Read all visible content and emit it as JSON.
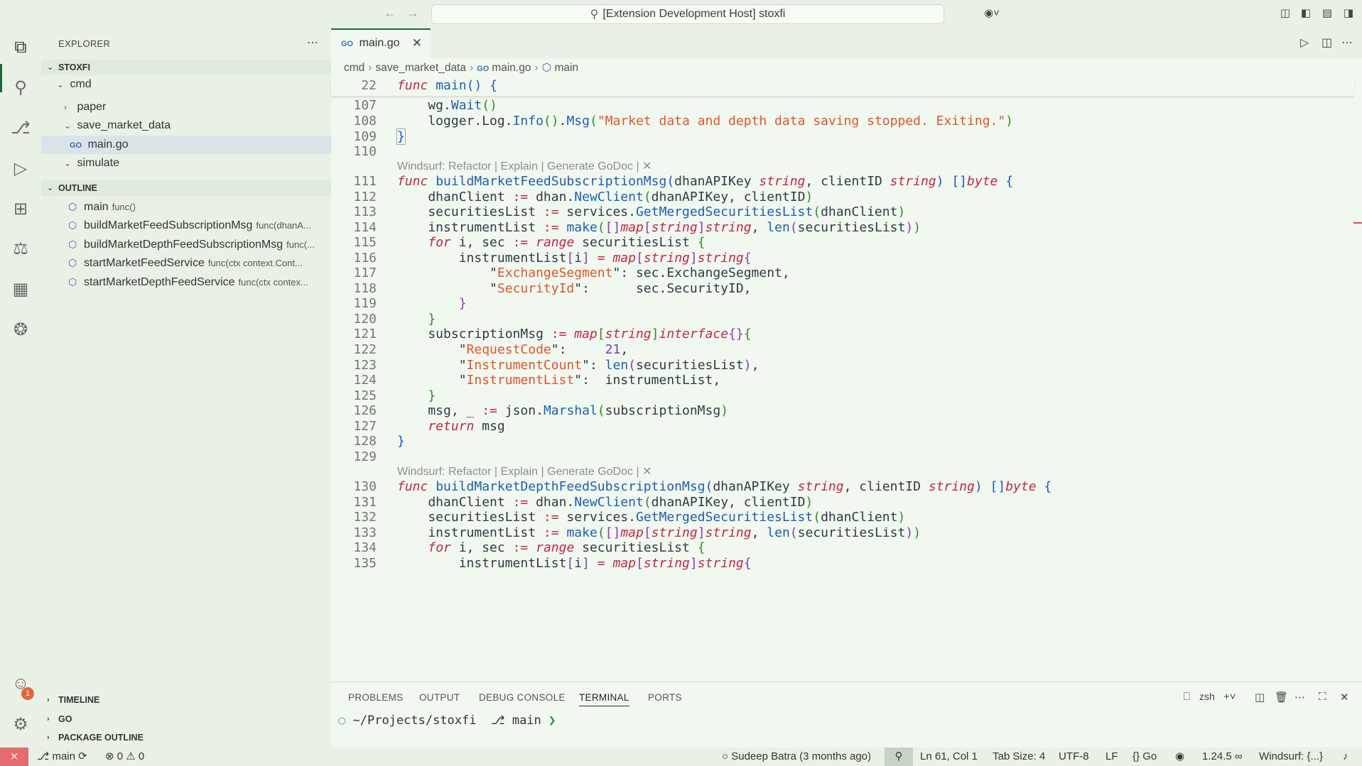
{
  "titlebar": {
    "search_text": "[Extension Development Host] stoxfi"
  },
  "sidebar": {
    "title": "EXPLORER",
    "folder": "STOXFI",
    "tree": [
      {
        "label": "cmd"
      },
      {
        "label": "paper"
      },
      {
        "label": "save_market_data"
      },
      {
        "label": "main.go"
      },
      {
        "label": "simulate"
      }
    ],
    "outline_title": "OUTLINE",
    "outline": [
      {
        "name": "main",
        "detail": "func()"
      },
      {
        "name": "buildMarketFeedSubscriptionMsg",
        "detail": "func(dhanA..."
      },
      {
        "name": "buildMarketDepthFeedSubscriptionMsg",
        "detail": "func(..."
      },
      {
        "name": "startMarketFeedService",
        "detail": "func(ctx context.Cont..."
      },
      {
        "name": "startMarketDepthFeedService",
        "detail": "func(ctx contex..."
      }
    ],
    "bottom_sections": [
      "TIMELINE",
      "GO",
      "PACKAGE OUTLINE"
    ]
  },
  "editor": {
    "tab_label": "main.go",
    "breadcrumb": [
      "cmd",
      "save_market_data",
      "main.go",
      "main"
    ],
    "sticky_line_number": "22",
    "codelens": "Windsurf: Refactor | Explain | Generate GoDoc | ✕",
    "line_numbers": [
      "107",
      "108",
      "109",
      "110",
      "",
      "111",
      "112",
      "113",
      "114",
      "115",
      "116",
      "117",
      "118",
      "119",
      "120",
      "121",
      "122",
      "123",
      "124",
      "125",
      "126",
      "127",
      "128",
      "129",
      "",
      "130",
      "131",
      "132",
      "133",
      "134",
      "135"
    ]
  },
  "panel": {
    "tabs": [
      "PROBLEMS",
      "OUTPUT",
      "DEBUG CONSOLE",
      "TERMINAL",
      "PORTS"
    ],
    "active_tab": "TERMINAL",
    "shell": "zsh",
    "terminal_path": "~/Projects/stoxfi",
    "terminal_branch": "main"
  },
  "statusbar": {
    "branch": "main",
    "errors": "0",
    "warnings": "0",
    "blame": "Sudeep Batra (3 months ago)",
    "position": "Ln 61, Col 1",
    "tab_size": "Tab Size: 4",
    "encoding": "UTF-8",
    "eol": "LF",
    "language": "Go",
    "go_version": "1.24.5",
    "windsurf": "Windsurf: {...}"
  },
  "activity_badge": "1",
  "colors": {
    "accent": "#1f6a3a",
    "keyword": "#c3264d",
    "function": "#1c5fb0",
    "string": "#e0552b",
    "remote": "#e56b6f"
  }
}
